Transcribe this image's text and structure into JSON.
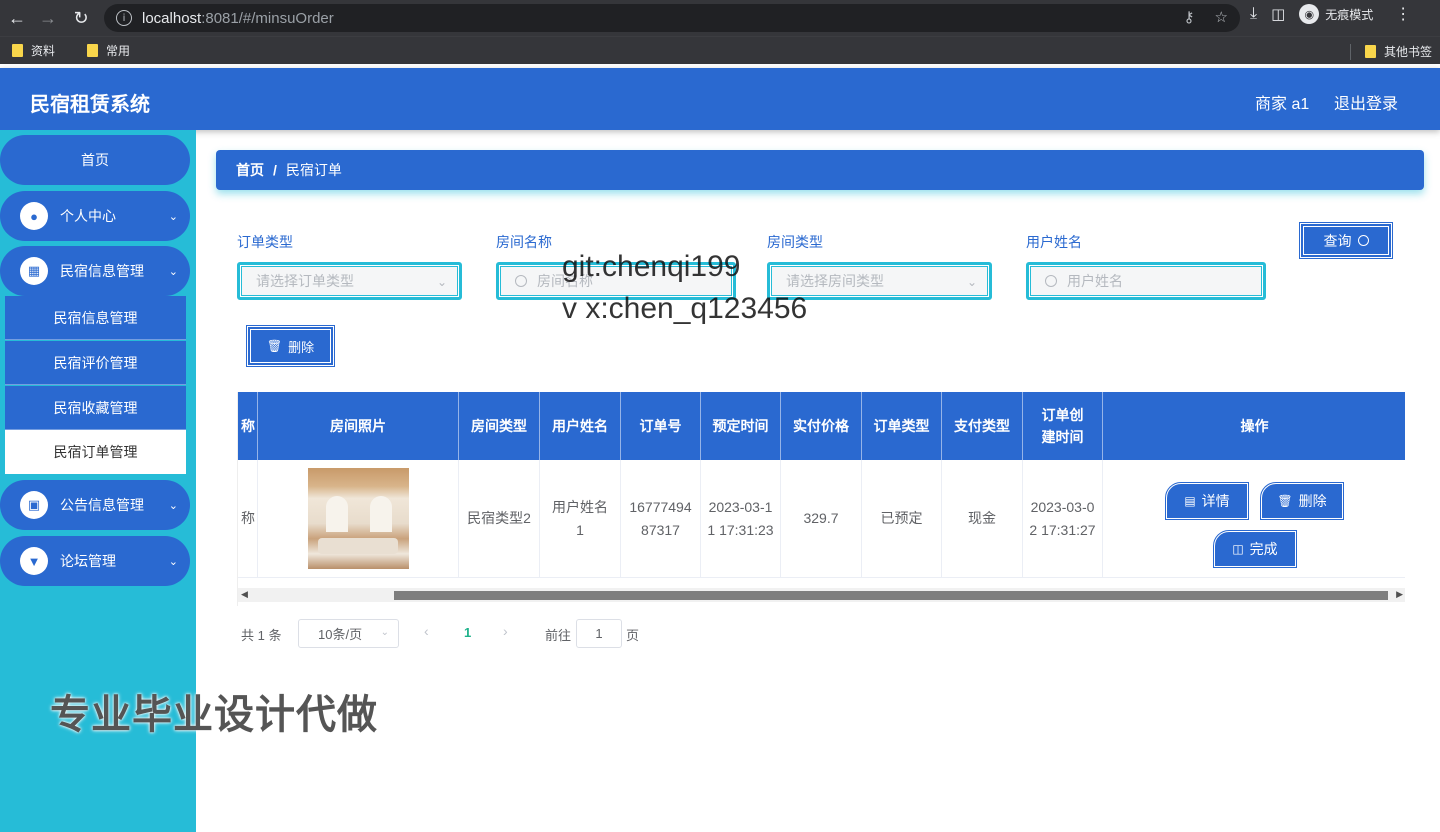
{
  "browser": {
    "url_host": "localhost",
    "url_rest": ":8081/#/minsuOrder",
    "incognito_label": "无痕模式",
    "bookmarks": [
      "资料",
      "常用"
    ],
    "other_bookmarks": "其他书签"
  },
  "header": {
    "title": "民宿租赁系统",
    "user": "商家 a1",
    "logout": "退出登录"
  },
  "sidebar": {
    "home": "首页",
    "personal": "个人中心",
    "minsu_info": "民宿信息管理",
    "sub_items": [
      "民宿信息管理",
      "民宿评价管理",
      "民宿收藏管理",
      "民宿订单管理"
    ],
    "notice": "公告信息管理",
    "forum": "论坛管理"
  },
  "breadcrumb": {
    "home": "首页",
    "separator": "/",
    "current": "民宿订单"
  },
  "filters": {
    "order_type_label": "订单类型",
    "order_type_placeholder": "请选择订单类型",
    "room_name_label": "房间名称",
    "room_name_placeholder": "房间名称",
    "room_type_label": "房间类型",
    "room_type_placeholder": "请选择房间类型",
    "user_name_label": "用户姓名",
    "user_name_placeholder": "用户姓名",
    "query_button": "查询",
    "delete_button": "删除"
  },
  "table": {
    "columns": [
      "称",
      "房间照片",
      "房间类型",
      "用户姓名",
      "订单号",
      "预定时间",
      "实付价格",
      "订单类型",
      "支付类型",
      "订单创建时间",
      "操作"
    ],
    "rows": [
      {
        "partial": "称",
        "room_type": "民宿类型2",
        "user_name": "用户姓名1",
        "order_no": "1677749487317",
        "reserve_time": "2023-03-11 17:31:23",
        "price": "329.7",
        "order_type": "已预定",
        "pay_type": "现金",
        "created_time": "2023-03-02 17:31:27",
        "actions": {
          "detail": "详情",
          "delete": "删除",
          "complete": "完成"
        }
      }
    ]
  },
  "pagination": {
    "total": "共 1 条",
    "page_size": "10条/页",
    "current_page": "1",
    "goto_prefix": "前往",
    "goto_value": "1",
    "goto_suffix": "页"
  },
  "watermarks": {
    "line1": "git:chenqi199",
    "line2": "v x:chen_q123456",
    "line3": "专业毕业设计代做"
  },
  "colors": {
    "primary": "#2a69d0",
    "sidebar_bg": "#26bcd7",
    "accent_page": "#1fb28a"
  }
}
